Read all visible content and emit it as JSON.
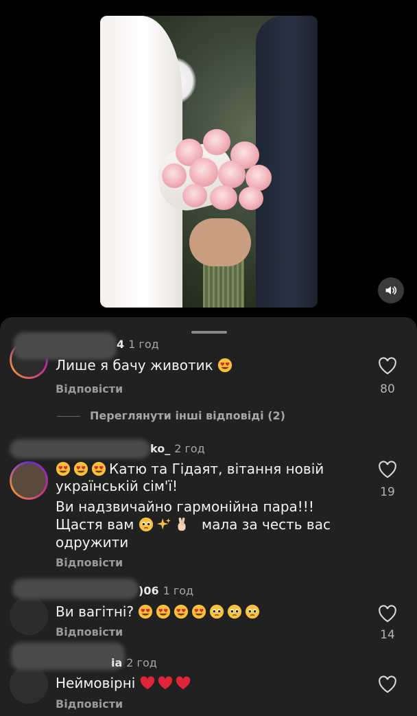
{
  "comments": [
    {
      "username_visible": "4",
      "time": "1 год",
      "text": "Лише я бачу животик",
      "emojis": [
        "heart-eyes"
      ],
      "reply_label": "Відповісти",
      "likes": "80"
    },
    {
      "username_visible": "ko_",
      "time": "2 год",
      "lines": [
        "Катю та Гідаят, вітання новій",
        "українській сім'ї!",
        "Ви надзвичайно гармонійна пара!!!",
        "Щастя вам",
        "мала за честь вас",
        "одружити"
      ],
      "reply_label": "Відповісти",
      "likes": "19"
    },
    {
      "username_visible": ")06",
      "time": "1 год",
      "text": "Ви вагітні?",
      "reply_label": "Відповісти",
      "likes": "14"
    },
    {
      "username_visible": "ia",
      "time": "2 год",
      "text": "Неймовірні",
      "reply_label": "Відповісти",
      "likes": ""
    }
  ],
  "view_more_replies": "Переглянути інші відповіді (2)",
  "colors": {
    "sheet_bg": "#212121",
    "heart_red": "#e0243a",
    "emoji_yellow": "#f7c23a"
  },
  "icons": {
    "sound": "speaker-icon",
    "like": "heart-outline-icon"
  }
}
